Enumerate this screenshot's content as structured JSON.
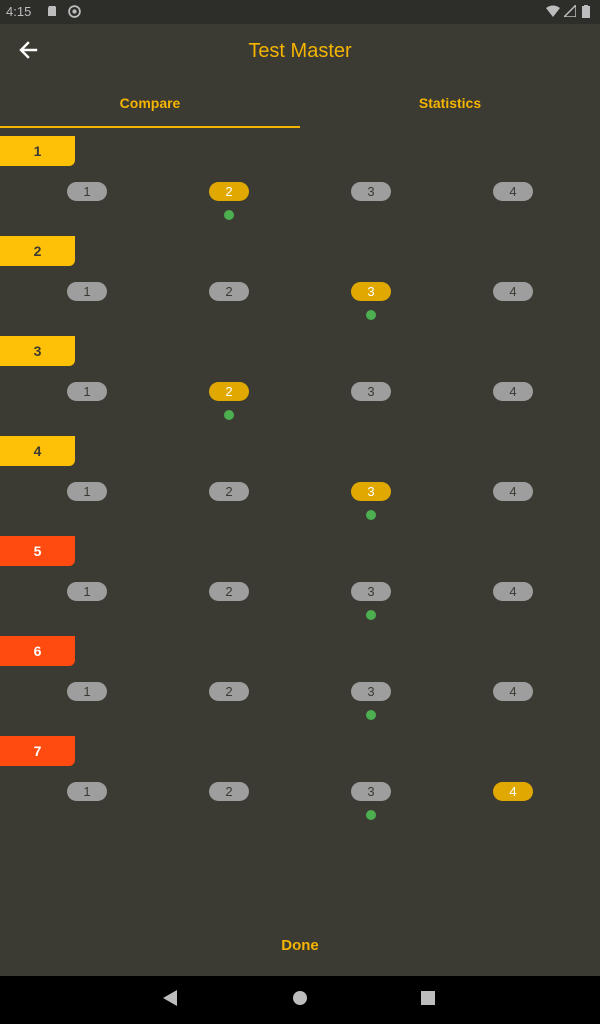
{
  "status_bar": {
    "time": "4:15",
    "icons": [
      "sd-card-icon",
      "sync-icon",
      "wifi-icon",
      "signal-icon",
      "battery-icon"
    ]
  },
  "app_bar": {
    "title": "Test Master",
    "back_icon": "arrow-left-icon"
  },
  "tabs": [
    {
      "label": "Compare",
      "selected": true
    },
    {
      "label": "Statistics",
      "selected": false
    }
  ],
  "questions": [
    {
      "number": "1",
      "label_color": "yellow",
      "options": [
        "1",
        "2",
        "3",
        "4"
      ],
      "selected_option": "2",
      "correct_option": "2"
    },
    {
      "number": "2",
      "label_color": "yellow",
      "options": [
        "1",
        "2",
        "3",
        "4"
      ],
      "selected_option": "3",
      "correct_option": "3"
    },
    {
      "number": "3",
      "label_color": "yellow",
      "options": [
        "1",
        "2",
        "3",
        "4"
      ],
      "selected_option": "2",
      "correct_option": "2"
    },
    {
      "number": "4",
      "label_color": "yellow",
      "options": [
        "1",
        "2",
        "3",
        "4"
      ],
      "selected_option": "3",
      "correct_option": "3"
    },
    {
      "number": "5",
      "label_color": "orange",
      "options": [
        "1",
        "2",
        "3",
        "4"
      ],
      "selected_option": null,
      "correct_option": "3"
    },
    {
      "number": "6",
      "label_color": "orange",
      "options": [
        "1",
        "2",
        "3",
        "4"
      ],
      "selected_option": null,
      "correct_option": "3"
    },
    {
      "number": "7",
      "label_color": "orange",
      "options": [
        "1",
        "2",
        "3",
        "4"
      ],
      "selected_option": "4",
      "correct_option": "3"
    }
  ],
  "done_label": "Done",
  "colors": {
    "background": "#3b3a33",
    "accent": "#f5b400",
    "label_yellow": "#ffc107",
    "label_orange": "#ff4b0f",
    "option_default": "#9e9e9e",
    "option_selected": "#e0a800",
    "correct_dot": "#4caf50"
  },
  "nav_bar": {
    "icons": [
      "back-triangle-icon",
      "home-circle-icon",
      "recents-square-icon"
    ]
  }
}
